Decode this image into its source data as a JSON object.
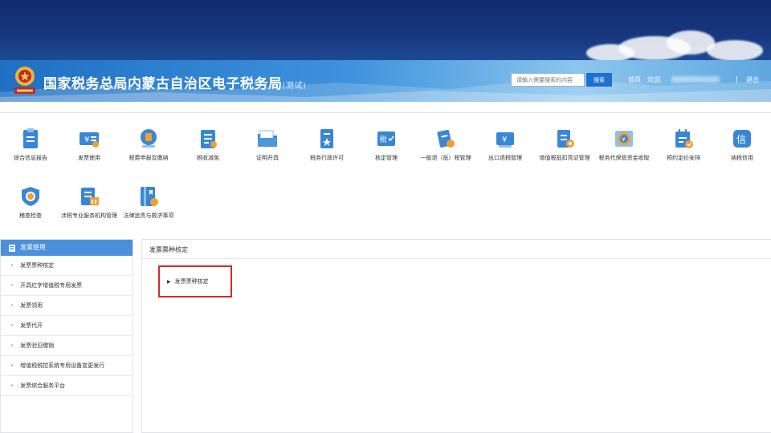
{
  "header": {
    "title": "国家税务总局内蒙古自治区电子税务局",
    "test_tag": "(测试)",
    "search": {
      "placeholder": "请输入需要搜索的内容",
      "button_label": "搜索"
    },
    "nav": {
      "home": "首页",
      "welcome": "欢迎,",
      "separator": "|",
      "logout": "退出"
    }
  },
  "menu": {
    "items": [
      {
        "label": "综合信息报告",
        "icon": "report-icon"
      },
      {
        "label": "发票使用",
        "icon": "invoice-icon"
      },
      {
        "label": "税费申报及缴纳",
        "icon": "tax-declare-icon"
      },
      {
        "label": "税收减免",
        "icon": "tax-relief-icon"
      },
      {
        "label": "证明开具",
        "icon": "certificate-folder-icon"
      },
      {
        "label": "税务行政许可",
        "icon": "license-icon"
      },
      {
        "label": "核定管理",
        "icon": "assessment-icon"
      },
      {
        "label": "一般退（抵）税管理",
        "icon": "refund-icon"
      },
      {
        "label": "出口退税管理",
        "icon": "export-refund-icon"
      },
      {
        "label": "增值税抵扣凭证管理",
        "icon": "vat-voucher-icon"
      },
      {
        "label": "税务代保管资金收取",
        "icon": "custody-fund-icon"
      },
      {
        "label": "预约定价安排",
        "icon": "pricing-calendar-icon"
      },
      {
        "label": "纳税信用",
        "icon": "credit-icon"
      },
      {
        "label": "稽查检查",
        "icon": "inspection-shield-icon"
      },
      {
        "label": "涉税专业服务机构管理",
        "icon": "agency-icon"
      },
      {
        "label": "法律追责与救济事项",
        "icon": "law-book-icon"
      }
    ]
  },
  "sidebar": {
    "header": "发票使用",
    "items": [
      {
        "label": "发票票种核定"
      },
      {
        "label": "开具红字增值税专用发票"
      },
      {
        "label": "发票领用"
      },
      {
        "label": "发票代开"
      },
      {
        "label": "发票验旧缴销"
      },
      {
        "label": "增值税税控系统专用设备变更发行"
      },
      {
        "label": "发票综合服务平台"
      }
    ]
  },
  "content": {
    "title": "发票票种核定",
    "tree": [
      {
        "label": "发票票种核定"
      }
    ]
  },
  "colors": {
    "top_band": "#17377f",
    "header_blue": "#3d92dc",
    "accent": "#4a90dc",
    "highlight_red": "#d42a2a",
    "icon_blue": "#3a86d6",
    "icon_orange": "#f0a030"
  }
}
